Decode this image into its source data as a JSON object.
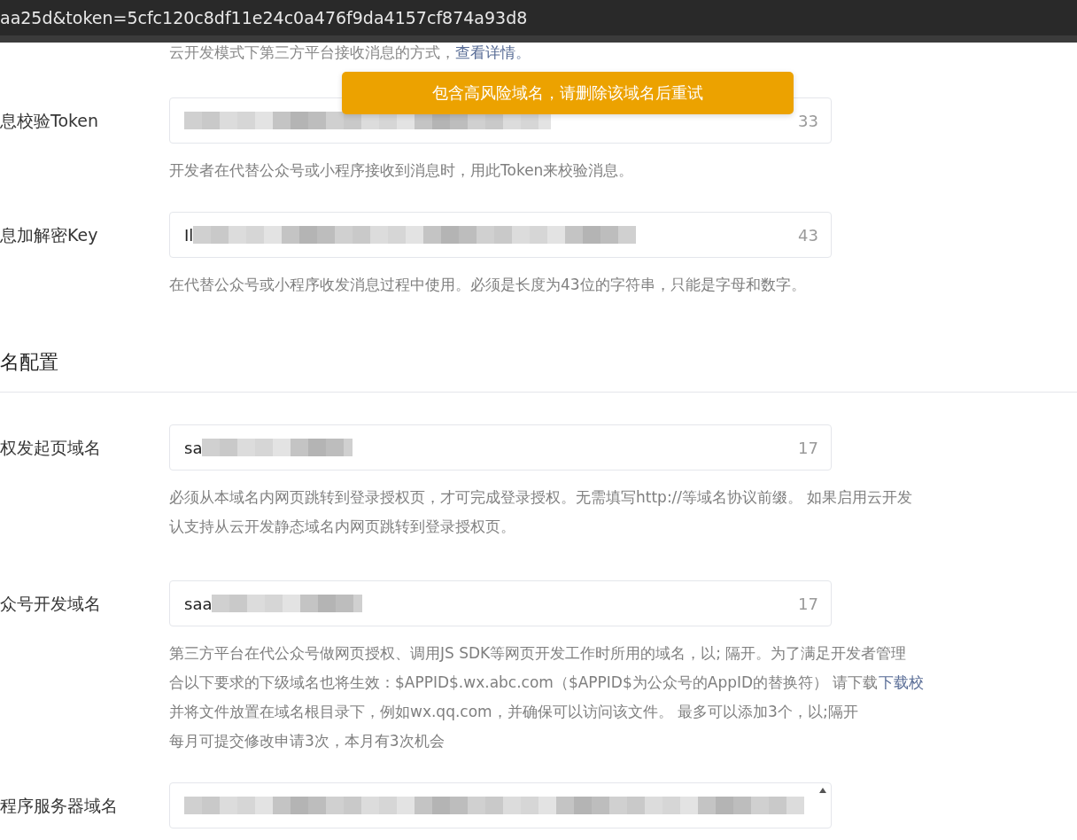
{
  "address_bar": {
    "url": "aa25d&token=5cfc120c8df11e24c0a476f9da4157cf874a93d8"
  },
  "intro": {
    "text": "云开发模式下第三方平台接收消息的方式，",
    "link": "查看详情。"
  },
  "toast": {
    "text": "包含高风险域名，请删除该域名后重试"
  },
  "fields": [
    {
      "label": "息校验Token",
      "count": "33",
      "help": [
        "开发者在代替公众号或小程序接收到消息时，用此Token来校验消息。"
      ]
    },
    {
      "label": "息加解密Key",
      "value": "Il",
      "count": "43",
      "help": [
        "在代替公众号或小程序收发消息过程中使用。必须是长度为43位的字符串，只能是字母和数字。"
      ]
    }
  ],
  "section": {
    "title": "名配置"
  },
  "domains": [
    {
      "label": "权发起页域名",
      "value": "sa",
      "count": "17",
      "help": [
        "必须从本域名内网页跳转到登录授权页，才可完成登录授权。无需填写http://等域名协议前缀。 如果启用云开发",
        "认支持从云开发静态域名内网页跳转到登录授权页。"
      ]
    },
    {
      "label": "众号开发域名",
      "value": "saa",
      "count": "17",
      "help": [
        "第三方平台在代公众号做网页授权、调用JS SDK等网页开发工作时所用的域名，以; 隔开。为了满足开发者管理",
        "合以下要求的下级域名也将生效：$APPID$.wx.abc.com（$APPID$为公众号的AppID的替换符） 请下载",
        "并将文件放置在域名根目录下，例如wx.qq.com，并确保可以访问该文件。 最多可以添加3个，以;隔开",
        "每月可提交修改申请3次，本月有3次机会"
      ],
      "link": "下载校"
    },
    {
      "label": "程序服务器域名"
    }
  ]
}
